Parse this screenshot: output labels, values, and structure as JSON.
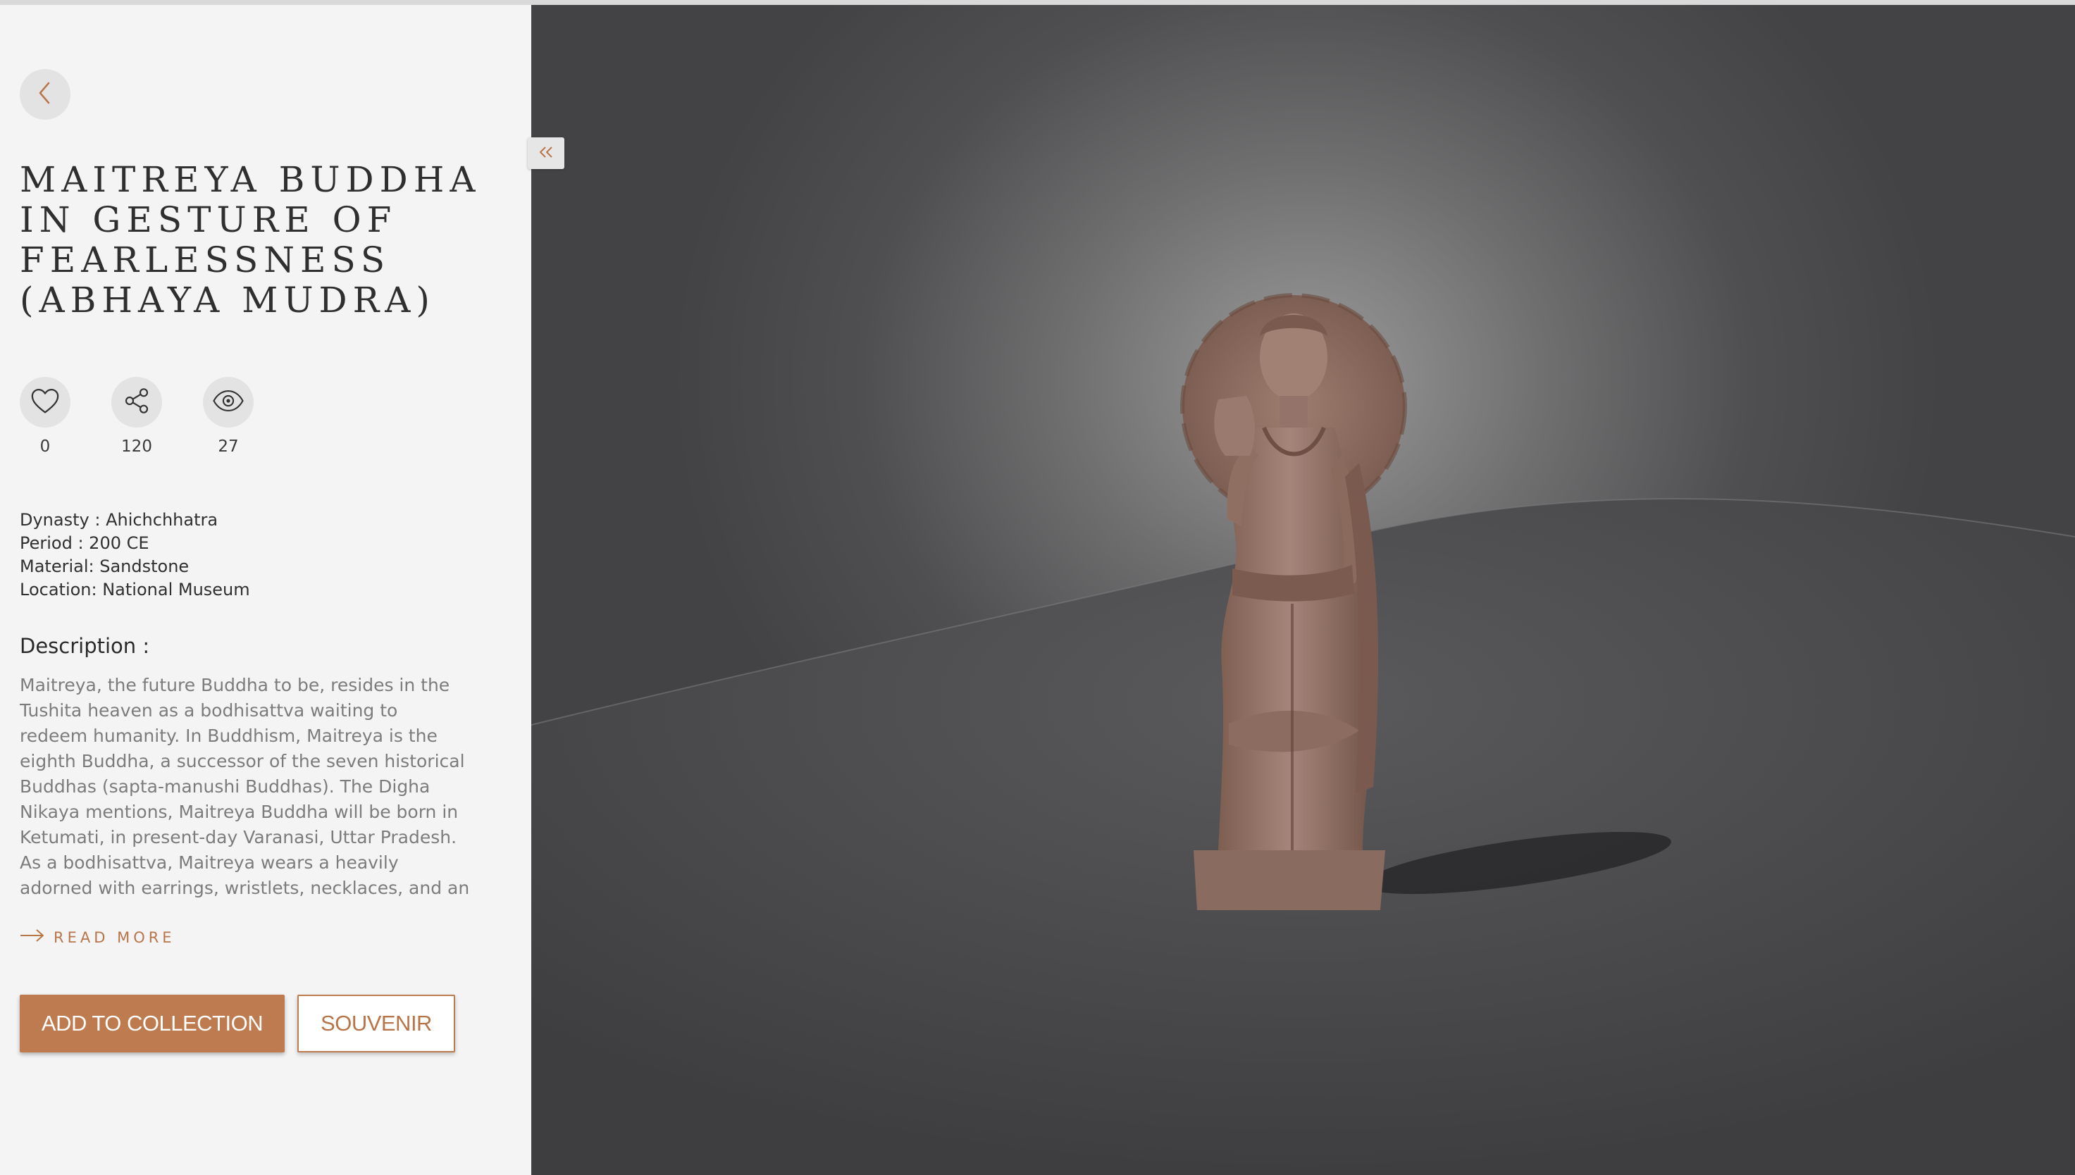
{
  "artifact": {
    "title": "Maitreya Buddha in Gesture of Fearlessness (Abhaya Mudra)"
  },
  "stats": {
    "likes": "0",
    "shares": "120",
    "views": "27"
  },
  "metadata": {
    "dynasty": "Dynasty : Ahichchhatra",
    "period": "Period : 200 CE",
    "material": "Material: Sandstone",
    "location": "Location: National Museum"
  },
  "description": {
    "heading": "Description :",
    "text": "Maitreya, the future Buddha to be, resides in the Tushita heaven as a bodhisattva waiting to redeem humanity. In Buddhism, Maitreya is the eighth Buddha, a successor of the seven historical Buddhas (sapta-manushi Buddhas). The Digha Nikaya mentions, Maitreya Buddha will be born in Ketumati, in present-day Varanasi, Uttar Pradesh. As a bodhisattva, Maitreya wears a heavily adorned with earrings, wristlets, necklaces, and an amulet. The"
  },
  "actions": {
    "read_more": "READ MORE",
    "add_to_collection": "ADD TO COLLECTION",
    "souvenir": "SOUVENIR"
  },
  "icons": {
    "back": "chevron-left-icon",
    "like": "heart-icon",
    "share": "share-icon",
    "views": "eye-icon",
    "read_more": "arrow-right-icon",
    "collapse": "double-chevron-left-icon"
  },
  "colors": {
    "accent": "#bd7b4f",
    "panel_bg": "#f4f4f5",
    "viewer_bg": "#4f4f51"
  }
}
